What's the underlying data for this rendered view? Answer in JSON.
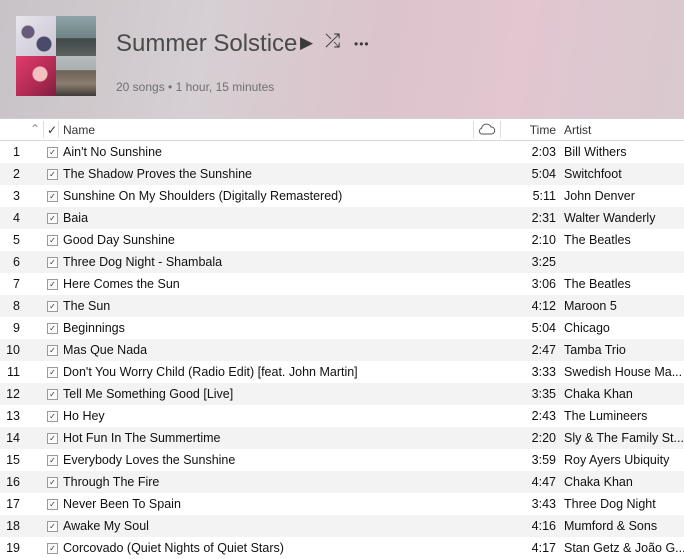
{
  "playlist": {
    "title": "Summer Solstice",
    "subtitle": "20 songs • 1 hour, 15 minutes",
    "play_icon": "▶",
    "shuffle_icon": "⤮",
    "more_icon": "•••"
  },
  "columns": {
    "sort_arrow": "⌃",
    "check": "✓",
    "name": "Name",
    "time": "Time",
    "artist": "Artist"
  },
  "tracks": [
    {
      "num": "1",
      "name": "Ain't No Sunshine",
      "time": "2:03",
      "artist": "Bill Withers"
    },
    {
      "num": "2",
      "name": "The Shadow Proves the Sunshine",
      "time": "5:04",
      "artist": "Switchfoot"
    },
    {
      "num": "3",
      "name": "Sunshine On My Shoulders (Digitally Remastered)",
      "time": "5:11",
      "artist": "John Denver"
    },
    {
      "num": "4",
      "name": "Baia",
      "time": "2:31",
      "artist": "Walter Wanderly"
    },
    {
      "num": "5",
      "name": "Good Day Sunshine",
      "time": "2:10",
      "artist": "The Beatles"
    },
    {
      "num": "6",
      "name": "Three Dog Night - Shambala",
      "time": "3:25",
      "artist": ""
    },
    {
      "num": "7",
      "name": "Here Comes the Sun",
      "time": "3:06",
      "artist": "The Beatles"
    },
    {
      "num": "8",
      "name": "The Sun",
      "time": "4:12",
      "artist": "Maroon 5"
    },
    {
      "num": "9",
      "name": "Beginnings",
      "time": "5:04",
      "artist": "Chicago"
    },
    {
      "num": "10",
      "name": "Mas Que Nada",
      "time": "2:47",
      "artist": "Tamba Trio"
    },
    {
      "num": "11",
      "name": "Don't You Worry Child (Radio Edit) [feat. John Martin]",
      "time": "3:33",
      "artist": "Swedish House Ma..."
    },
    {
      "num": "12",
      "name": "Tell Me Something Good [Live]",
      "time": "3:35",
      "artist": "Chaka Khan"
    },
    {
      "num": "13",
      "name": "Ho Hey",
      "time": "2:43",
      "artist": "The Lumineers"
    },
    {
      "num": "14",
      "name": "Hot Fun In The Summertime",
      "time": "2:20",
      "artist": "Sly & The Family St..."
    },
    {
      "num": "15",
      "name": "Everybody Loves the Sunshine",
      "time": "3:59",
      "artist": "Roy Ayers Ubiquity"
    },
    {
      "num": "16",
      "name": "Through The Fire",
      "time": "4:47",
      "artist": "Chaka Khan"
    },
    {
      "num": "17",
      "name": "Never Been To Spain",
      "time": "3:43",
      "artist": "Three Dog Night"
    },
    {
      "num": "18",
      "name": "Awake My Soul",
      "time": "4:16",
      "artist": "Mumford & Sons"
    },
    {
      "num": "19",
      "name": "Corcovado (Quiet Nights of Quiet Stars)",
      "time": "4:17",
      "artist": "Stan Getz & João G..."
    }
  ]
}
